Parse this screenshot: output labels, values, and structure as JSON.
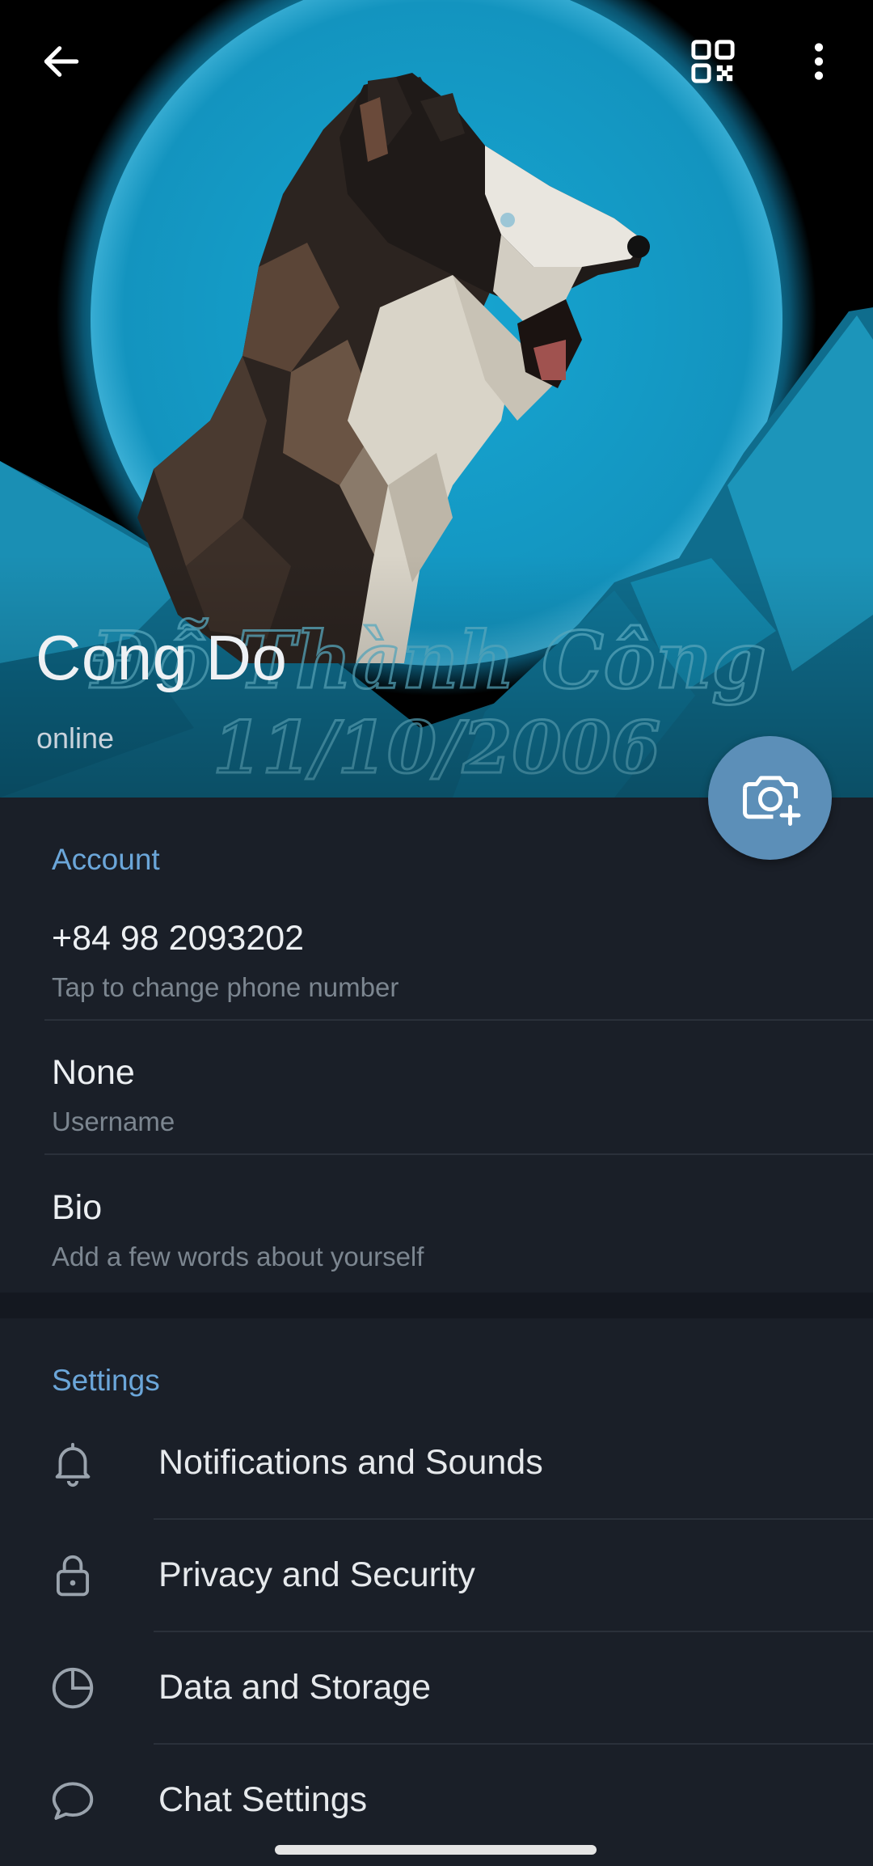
{
  "profile": {
    "name": "Cong Do",
    "status": "online",
    "photo_watermark_name": "Đỗ Thành Công",
    "photo_watermark_date": "11/10/2006"
  },
  "top_bar": {
    "back_icon": "arrow-left-icon",
    "qr_icon": "qr-code-icon",
    "more_icon": "more-vertical-icon"
  },
  "fab": {
    "icon": "camera-add-icon",
    "color": "#5c8fb8"
  },
  "account": {
    "title": "Account",
    "rows": [
      {
        "value": "+84 98 2093202",
        "caption": "Tap to change phone number"
      },
      {
        "value": "None",
        "caption": "Username"
      },
      {
        "value": "Bio",
        "caption": "Add a few words about yourself"
      }
    ]
  },
  "settings": {
    "title": "Settings",
    "items": [
      {
        "label": "Notifications and Sounds",
        "icon": "bell-icon"
      },
      {
        "label": "Privacy and Security",
        "icon": "lock-icon"
      },
      {
        "label": "Data and Storage",
        "icon": "pie-chart-icon"
      },
      {
        "label": "Chat Settings",
        "icon": "chat-bubble-icon"
      }
    ]
  },
  "colors": {
    "accent": "#6ba6d9",
    "background": "#1a1f28",
    "photo_blue": "#1596bf"
  }
}
